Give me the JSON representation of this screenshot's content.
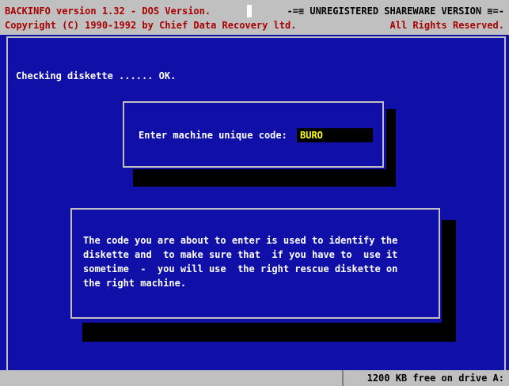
{
  "header": {
    "app_title": "BACKINFO version 1.32 - DOS Version.",
    "banner": "-=≡ UNREGISTERED SHAREWARE VERSION ≡=-",
    "copyright": "Copyright (C) 1990-1992 by Chief Data Recovery ltd.",
    "rights": "All Rights Reserved."
  },
  "main": {
    "check_status": "Checking diskette ...... OK."
  },
  "code_dialog": {
    "prompt": "Enter machine unique code:",
    "value": "BURO"
  },
  "info_box": {
    "text": "The code you are about to enter is used to identify the\ndiskette and  to make sure that  if you have to  use it\nsometime  -  you will use  the right rescue diskette on\nthe right machine."
  },
  "status_bar": {
    "free_space": "1200 KB free on drive A:"
  }
}
